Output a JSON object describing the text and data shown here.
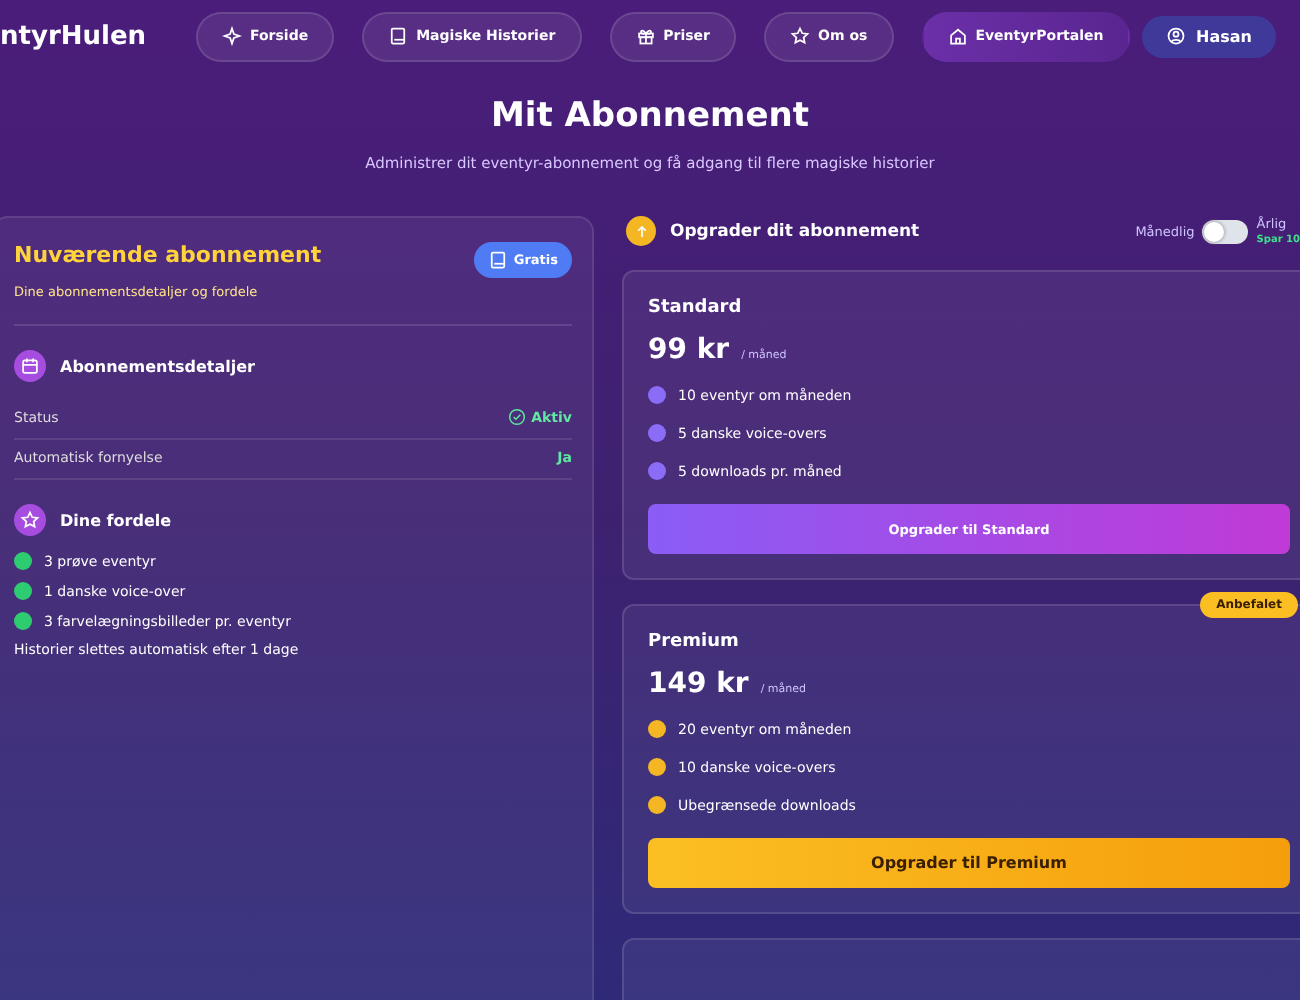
{
  "header": {
    "logo": "ntyrHulen",
    "nav": [
      {
        "label": "Forside",
        "selected": false
      },
      {
        "label": "Magiske Historier",
        "selected": false
      },
      {
        "label": "Priser",
        "selected": false
      },
      {
        "label": "Om os",
        "selected": false
      },
      {
        "label": "EventyrPortalen",
        "selected": true
      }
    ],
    "user": "Hasan"
  },
  "page": {
    "title": "Mit Abonnement",
    "subtitle": "Administrer dit eventyr-abonnement og få adgang til flere magiske historier"
  },
  "current": {
    "title": "Nuværende abonnement",
    "subtitle": "Dine abonnementsdetaljer og fordele",
    "plan_badge": "Gratis",
    "details_title": "Abonnementsdetaljer",
    "details": [
      {
        "label": "Status",
        "value": "Aktiv",
        "checked": true
      },
      {
        "label": "Automatisk fornyelse",
        "value": "Ja",
        "checked": false
      }
    ],
    "benefits_title": "Dine fordele",
    "benefits": [
      "3 prøve eventyr",
      "1 danske voice-over",
      "3 farvelægningsbilleder pr. eventyr"
    ],
    "note": "Historier slettes automatisk efter 1 dage"
  },
  "upgrade": {
    "title": "Opgrader dit abonnement",
    "monthly": "Månedlig",
    "annual": "Årlig",
    "annual_on": false,
    "save": "Spar 10",
    "plans": [
      {
        "kind": "standard",
        "name": "Standard",
        "price": "99 kr",
        "period": "/ måned",
        "features": [
          "10 eventyr om måneden",
          "5 danske voice-overs",
          "5 downloads pr. måned"
        ],
        "button": "Opgrader til Standard"
      },
      {
        "kind": "premium",
        "name": "Premium",
        "price": "149 kr",
        "period": "/ måned",
        "badge": "Anbefalet",
        "features": [
          "20 eventyr om måneden",
          "10 danske voice-overs",
          "Ubegrænsede downloads"
        ],
        "button": "Opgrader til Premium"
      }
    ]
  }
}
